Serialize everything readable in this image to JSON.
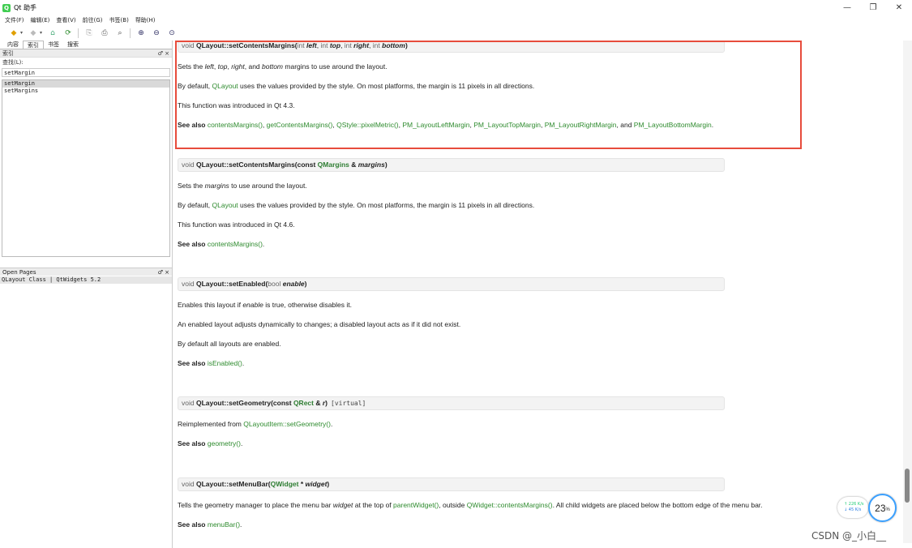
{
  "window": {
    "title": "Qt 助手",
    "app_icon": "Q",
    "controls": {
      "minimize": "—",
      "maximize": "❐",
      "close": "✕"
    }
  },
  "menu": [
    "文件(F)",
    "编辑(E)",
    "查看(V)",
    "前往(G)",
    "书签(B)",
    "帮助(H)"
  ],
  "toolbar": {
    "back_icon": "◆",
    "dropdown": "▾",
    "forward_icon": "◆",
    "home_icon": "⌂",
    "sync_icon": "⟳",
    "copy_icon": "⎘",
    "print_icon": "⎙",
    "find_icon": "⌕",
    "zoom_in_icon": "⊕",
    "zoom_out_icon": "⊖",
    "zoom_reset_icon": "⊙"
  },
  "sidebar": {
    "tabs": [
      "内容",
      "索引",
      "书签",
      "搜索"
    ],
    "dock_title": "索引",
    "dock_buttons": "♂ ×",
    "find_label": "查找(L):",
    "find_value": "setMargin",
    "index_items": [
      "setMargin",
      "setMargins"
    ],
    "open_pages_title": "Open Pages",
    "open_page": "QLayout Class | QtWidgets 5.2"
  },
  "content": {
    "fn1": {
      "void": "void",
      "name": "QLayout::setContentsMargins(",
      "int1": "int",
      "p1": "left",
      "int2": "int",
      "p2": "top",
      "int3": "int",
      "p3": "right",
      "int4": "int",
      "p4": "bottom",
      "close": ")",
      "sets_a": "Sets the ",
      "sets_left": "left",
      "sets_sep1": ", ",
      "sets_top": "top",
      "sets_sep2": ", ",
      "sets_right": "right",
      "sets_and": ", and ",
      "sets_bottom": "bottom",
      "sets_b": " margins to use around the layout.",
      "default_a": "By default, ",
      "default_link": "QLayout",
      "default_b": " uses the values provided by the style. On most platforms, the margin is 11 pixels in all directions.",
      "intro": "This function was introduced in Qt 4.3.",
      "see_also": "See also",
      "links": [
        "contentsMargins()",
        "getContentsMargins()",
        "QStyle::pixelMetric()",
        "PM_LayoutLeftMargin",
        "PM_LayoutTopMargin",
        "PM_LayoutRightMargin"
      ],
      "and": ", and ",
      "last_link": "PM_LayoutBottomMargin",
      "period": "."
    },
    "fn2": {
      "void": "void",
      "name": "QLayout::setContentsMargins(const ",
      "type": "QMargins",
      "amp": " & ",
      "param": "margins",
      "close": ")",
      "sets_a": "Sets the ",
      "sets_em": "margins",
      "sets_b": " to use around the layout.",
      "default_a": "By default, ",
      "default_link": "QLayout",
      "default_b": " uses the values provided by the style. On most platforms, the margin is 11 pixels in all directions.",
      "intro": "This function was introduced in Qt 4.6.",
      "see_also": "See also",
      "link": "contentsMargins()",
      "period": "."
    },
    "fn3": {
      "void": "void",
      "name": "QLayout::setEnabled(",
      "type": "bool",
      "param": "enable",
      "close": ")",
      "desc_a": "Enables this layout if ",
      "desc_em": "enable",
      "desc_b": " is true, otherwise disables it.",
      "desc2": "An enabled layout adjusts dynamically to changes; a disabled layout acts as if it did not exist.",
      "desc3": "By default all layouts are enabled.",
      "see_also": "See also",
      "link": "isEnabled()",
      "period": "."
    },
    "fn4": {
      "void": "void",
      "name": "QLayout::setGeometry(const ",
      "type": "QRect",
      "amp": " & ",
      "param": "r",
      "close": ")",
      "virtual": "[virtual]",
      "reimpl_a": "Reimplemented from ",
      "reimpl_link": "QLayoutItem::setGeometry()",
      "reimpl_b": ".",
      "see_also": "See also",
      "link": "geometry()",
      "period": "."
    },
    "fn5": {
      "void": "void",
      "name": "QLayout::setMenuBar(",
      "type": "QWidget",
      "star": " * ",
      "param": "widget",
      "close": ")",
      "desc_a": "Tells the geometry manager to place the menu bar ",
      "desc_em": "widget",
      "desc_b": " at the top of ",
      "desc_link1": "parentWidget()",
      "desc_c": ", outside ",
      "desc_link2": "QWidget::contentsMargins()",
      "desc_d": ". All child widgets are placed below the bottom edge of the menu bar.",
      "see_also": "See also",
      "link": "menuBar()",
      "period": "."
    }
  },
  "overlay": {
    "net_up": "↑ 226 K/s",
    "net_down": "↓ 45  K/s",
    "cpu_value": "23",
    "cpu_unit": "%",
    "watermark": "CSDN @_小白__"
  },
  "colors": {
    "link": "#2e8b2e",
    "highlight": "#e74c3c",
    "type": "#2e7d32"
  }
}
